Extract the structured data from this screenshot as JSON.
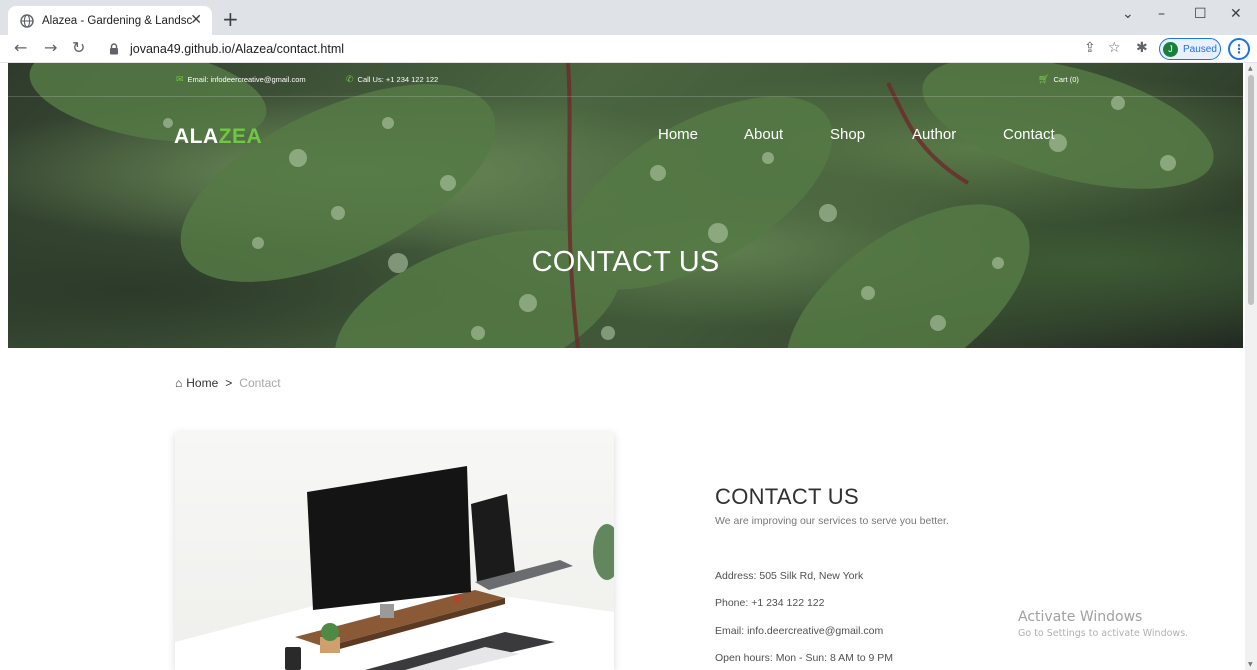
{
  "browser": {
    "tab_title": "Alazea - Gardening & Landscapi",
    "url": "jovana49.github.io/Alazea/contact.html",
    "profile_initial": "J",
    "profile_status": "Paused"
  },
  "topbar": {
    "email": "Email: infodeercreative@gmail.com",
    "phone": "Call Us: +1 234 122 122",
    "cart": "Cart (0)"
  },
  "header": {
    "logo_part1": "ALA",
    "logo_part2": "ZEA",
    "nav": [
      "Home",
      "About",
      "Shop",
      "Author",
      "Contact"
    ]
  },
  "hero": {
    "title": "CONTACT US"
  },
  "breadcrumb": {
    "home": "Home",
    "separator": ">",
    "current": "Contact"
  },
  "contact": {
    "title": "CONTACT US",
    "subtitle": "We are improving our services to serve you better.",
    "address": "Address: 505 Silk Rd, New York",
    "phone": "Phone: +1 234 122 122",
    "email": "Email: info.deercreative@gmail.com",
    "hours": "Open hours: Mon - Sun: 8 AM to 9 PM"
  },
  "watermark": {
    "line1": "Activate Windows",
    "line2": "Go to Settings to activate Windows."
  },
  "colors": {
    "accent": "#70c745",
    "chrome": "#dfe3e8",
    "link": "#1a73e8"
  },
  "icons": [
    "globe-icon",
    "close-icon",
    "plus-icon",
    "back-icon",
    "forward-icon",
    "reload-icon",
    "lock-icon",
    "share-icon",
    "star-icon",
    "extensions-icon",
    "kebab-menu-icon",
    "envelope-icon",
    "phone-icon",
    "cart-icon",
    "house-icon"
  ]
}
